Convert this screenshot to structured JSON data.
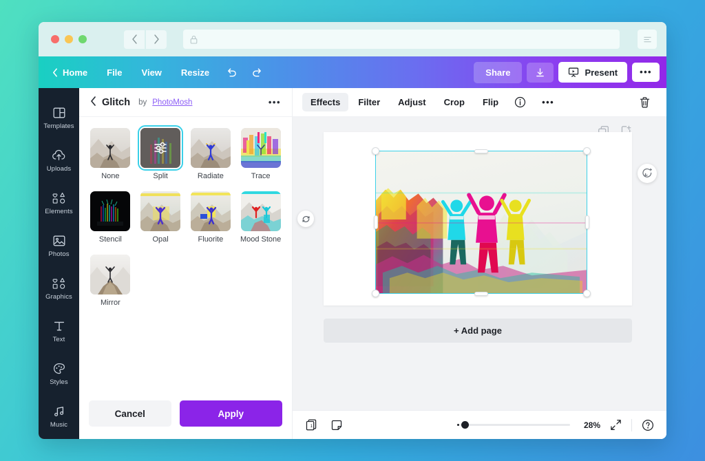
{
  "browser": {
    "address_value": "",
    "address_placeholder": "",
    "lock_icon": "lock-icon",
    "back_icon": "chevron-left-icon",
    "forward_icon": "chevron-right-icon",
    "menu_icon": "reader-settings-icon"
  },
  "toolbar": {
    "home_label": "Home",
    "file_label": "File",
    "view_label": "View",
    "resize_label": "Resize",
    "undo_icon": "undo-icon",
    "redo_icon": "redo-icon",
    "share_label": "Share",
    "download_icon": "download-icon",
    "present_label": "Present",
    "present_icon": "presentation-icon",
    "more_label": "•••"
  },
  "sidebar": {
    "items": [
      {
        "label": "Templates",
        "icon": "templates-icon"
      },
      {
        "label": "Uploads",
        "icon": "cloud-upload-icon"
      },
      {
        "label": "Elements",
        "icon": "shapes-icon"
      },
      {
        "label": "Photos",
        "icon": "image-icon"
      },
      {
        "label": "Graphics",
        "icon": "shapes-icon"
      },
      {
        "label": "Text",
        "icon": "text-icon"
      },
      {
        "label": "Styles",
        "icon": "palette-icon"
      },
      {
        "label": "Music",
        "icon": "music-note-icon"
      }
    ]
  },
  "panel": {
    "back_icon": "chevron-left-icon",
    "title": "Glitch",
    "by_label": "by",
    "author": "PhotoMosh",
    "more_label": "•••",
    "effects": [
      {
        "label": "None",
        "selected": false
      },
      {
        "label": "Split",
        "selected": true
      },
      {
        "label": "Radiate",
        "selected": false
      },
      {
        "label": "Trace",
        "selected": false
      },
      {
        "label": "Stencil",
        "selected": false
      },
      {
        "label": "Opal",
        "selected": false
      },
      {
        "label": "Fluorite",
        "selected": false
      },
      {
        "label": "Mood Stone",
        "selected": false
      },
      {
        "label": "Mirror",
        "selected": false
      }
    ],
    "cancel_label": "Cancel",
    "apply_label": "Apply"
  },
  "editor": {
    "tabs": [
      {
        "label": "Effects",
        "active": true
      },
      {
        "label": "Filter",
        "active": false
      },
      {
        "label": "Adjust",
        "active": false
      },
      {
        "label": "Crop",
        "active": false
      },
      {
        "label": "Flip",
        "active": false
      }
    ],
    "info_icon": "info-circle-icon",
    "more_label": "•••",
    "delete_icon": "trash-icon",
    "duplicate_icon": "duplicate-icon",
    "addpage_icon": "add-page-icon",
    "comment_icon": "comment-add-icon",
    "rotate_icon": "rotate-icon",
    "add_page_label": "+ Add page"
  },
  "status": {
    "pages_icon": "pages-icon",
    "notes_icon": "notes-icon",
    "zoom_value": "28%",
    "zoom_percent": 28,
    "fullscreen_icon": "expand-icon",
    "help_icon": "help-circle-icon"
  },
  "colors": {
    "accent_purple": "#8b24e8",
    "selection_cyan": "#3ad0e8",
    "sidebar_dark": "#16212e",
    "author_link": "#8b5cf6"
  }
}
